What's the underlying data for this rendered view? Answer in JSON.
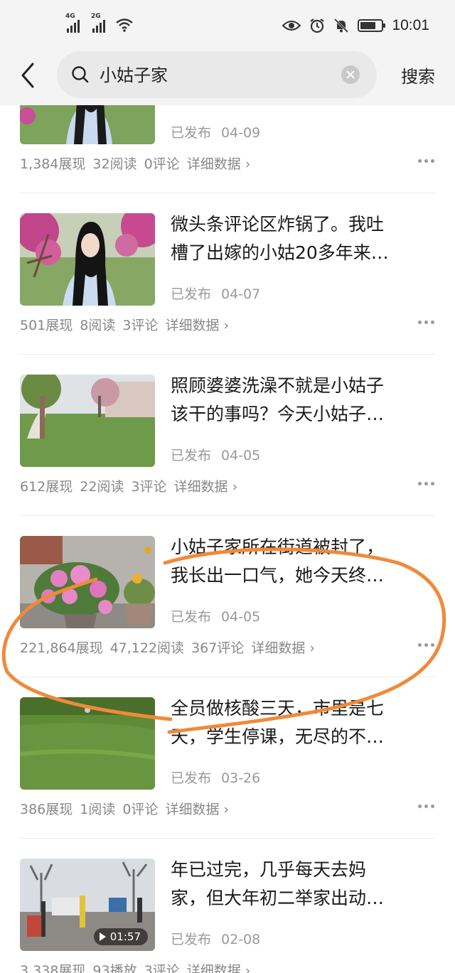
{
  "status_bar": {
    "net1": "4G",
    "net2": "2G",
    "time": "10:01",
    "battery_level": 0.75
  },
  "search": {
    "query": "小姑子家",
    "button_label": "搜索"
  },
  "items": [
    {
      "title_lines": [],
      "status": "已发布",
      "date": "04-09",
      "impressions": "1,384展现",
      "reads": "32阅读",
      "comments": "0评论",
      "detail": "详细数据 ›",
      "thumb": "woman-in-blossoms"
    },
    {
      "title_lines": [
        "微头条评论区炸锅了。我吐",
        "槽了出嫁的小姑20多年来…"
      ],
      "status": "已发布",
      "date": "04-07",
      "impressions": "501展现",
      "reads": "8阅读",
      "comments": "3评论",
      "detail": "详细数据 ›",
      "thumb": "woman-in-blossoms"
    },
    {
      "title_lines": [
        "照顾婆婆洗澡不就是小姑子",
        "该干的事吗？今天小姑子…"
      ],
      "status": "已发布",
      "date": "04-05",
      "impressions": "612展现",
      "reads": "22阅读",
      "comments": "3评论",
      "detail": "详细数据 ›",
      "thumb": "park-trees"
    },
    {
      "title_lines": [
        "小姑子家所在街道被封了，",
        "我长出一口气，她今天终…"
      ],
      "status": "已发布",
      "date": "04-05",
      "impressions": "221,864展现",
      "reads": "47,122阅读",
      "comments": "367评论",
      "detail": "详细数据 ›",
      "thumb": "potted-flowers"
    },
    {
      "title_lines": [
        "全员做核酸三天，市里是七",
        "天，学生停课，无尽的不…"
      ],
      "status": "已发布",
      "date": "03-26",
      "impressions": "386展现",
      "reads": "1阅读",
      "comments": "0评论",
      "detail": "详细数据 ›",
      "thumb": "green-field"
    },
    {
      "title_lines": [
        "年已过完，几乎每天去妈",
        "家，但大年初二举家出动…"
      ],
      "status": "已发布",
      "date": "02-08",
      "impressions": "3,338展现",
      "reads": "93播放",
      "comments": "3评论",
      "detail": "详细数据 ›",
      "thumb": "street-scene",
      "video_duration": "01:57"
    }
  ],
  "colors": {
    "annotation": "#ef8a3a",
    "meta_text": "#999999",
    "bar_bg": "#f4f4f4"
  }
}
